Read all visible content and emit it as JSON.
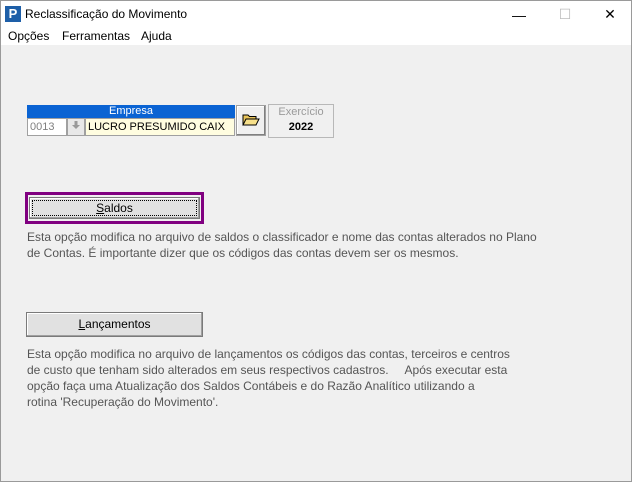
{
  "window": {
    "title": "Reclassificação do Movimento",
    "app_icon_letter": "P",
    "controls": {
      "minimize": "—",
      "maximize": "☐",
      "close": "✕"
    }
  },
  "menu": [
    "Opções",
    "Ferramentas",
    "Ajuda"
  ],
  "empresa": {
    "header": "Empresa",
    "code": "0013",
    "name": "LUCRO PRESUMIDO CAIX",
    "dropdown_icon": "down-arrow-icon",
    "folder_icon": "open-folder-icon"
  },
  "exercicio": {
    "label": "Exercício",
    "value": "2022"
  },
  "saldos": {
    "button_label_first": "S",
    "button_label_rest": "aldos",
    "description_lines": [
      "Esta opção modifica no arquivo de saldos o classificador e nome das contas alterados no Plano",
      "de Contas. É importante dizer que os códigos das contas devem ser os mesmos."
    ]
  },
  "lancamentos": {
    "button_label_first": "L",
    "button_label_rest": "ançamentos",
    "description_lines": [
      "Esta opção modifica no arquivo de lançamentos os códigos das contas, terceiros e centros",
      "de custo que tenham sido alterados em seus respectivos cadastros.     Após executar esta",
      "opção faça uma Atualização dos Saldos Contábeis e do Razão Analítico utilizando a",
      "rotina 'Recuperação do Movimento'."
    ]
  },
  "colors": {
    "accent": "#0a63d3",
    "focus": "#800080",
    "input_bg": "#fffde0"
  }
}
